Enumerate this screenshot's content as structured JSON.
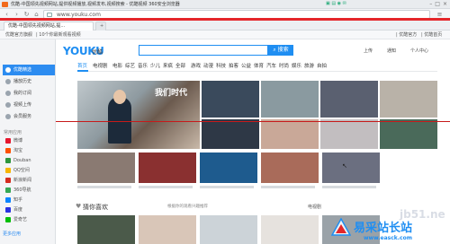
{
  "browser": {
    "window_title": "优酷-中国领先视频网站,提供视频播放,视频发布,视频搜索 - 优酷视频     360安全浏览器",
    "address": "www.youku.com",
    "tabs": [
      {
        "label": "优酷-中国领先视频网站,提..."
      },
      {
        "label": "+"
      }
    ],
    "bookmarks": [
      "优酷官方旗舰",
      "| 10个你最新观看视频",
      "| 优酷官方",
      "| 优酷首页"
    ],
    "sidebar_items": [
      {
        "label": "优酷精选"
      },
      {
        "label": "播放历史"
      },
      {
        "label": "我的订阅"
      },
      {
        "label": "视频上传"
      },
      {
        "label": "会员服务"
      }
    ],
    "sidebar_heading": "常用应用",
    "sidebar_apps": [
      {
        "label": "微博",
        "color": "#e6162d"
      },
      {
        "label": "淘宝",
        "color": "#ff5000"
      },
      {
        "label": "Douban",
        "color": "#2e963d"
      },
      {
        "label": "QQ空间",
        "color": "#f7b500"
      },
      {
        "label": "新浪新闻",
        "color": "#d52b1e"
      },
      {
        "label": "360导航",
        "color": "#34a853"
      },
      {
        "label": "知乎",
        "color": "#0a84ff"
      },
      {
        "label": "百度",
        "color": "#2932e1"
      },
      {
        "label": "爱奇艺",
        "color": "#00be06"
      }
    ],
    "sidebar_bottom": "更多应用"
  },
  "page": {
    "logo": "YOUKU",
    "logo_cn": "优酷",
    "search_button": "搜索",
    "top_right": [
      "上传",
      "通知",
      "个人中心"
    ],
    "nav": [
      "首页",
      "电视剧",
      "电影",
      "综艺",
      "音乐",
      "少儿",
      "来疯",
      "全部",
      "游戏",
      "动漫",
      "科技",
      "拍客",
      "公益",
      "体育",
      "汽车",
      "时尚",
      "娱乐",
      "旅游",
      "自拍"
    ],
    "hero_overlay": "我们时代",
    "tiles_row1": [
      {
        "cap": "",
        "bg": "#7a8e8e"
      },
      {
        "cap": "",
        "bg": "#3a4a5c"
      },
      {
        "cap": "",
        "bg": "#8a9aa0"
      },
      {
        "cap": "",
        "bg": "#5a6070"
      },
      {
        "cap": "",
        "bg": "#b9b2a8"
      }
    ],
    "tiles_row2": [
      {
        "cap": "",
        "bg": "#2e3846"
      },
      {
        "cap": "",
        "bg": "#c9a898"
      },
      {
        "cap": "",
        "bg": "#c2bec0"
      },
      {
        "cap": "",
        "bg": "#4a6a5a"
      },
      {
        "cap": "",
        "bg": "#7b8a96"
      }
    ],
    "tiles_row3": [
      {
        "cap": "",
        "bg": "#8a7a72"
      },
      {
        "cap": "",
        "bg": "#8a3030"
      },
      {
        "cap": "",
        "bg": "#1e5b8e"
      },
      {
        "cap": "",
        "bg": "#a96b5a"
      },
      {
        "cap": "",
        "bg": "#6b6f80"
      }
    ],
    "section_title": "猜你喜欢",
    "section_mid": "根据你的观看兴趣推荐",
    "section_tv": "电视剧"
  },
  "watermark": {
    "site": "易采站长站",
    "url": "www.easck.com",
    "frag": "jb51.ne"
  },
  "colors": {
    "accent": "#1f8ef2",
    "red_line": "#c71a1a",
    "browser_red": "#e4262a"
  }
}
